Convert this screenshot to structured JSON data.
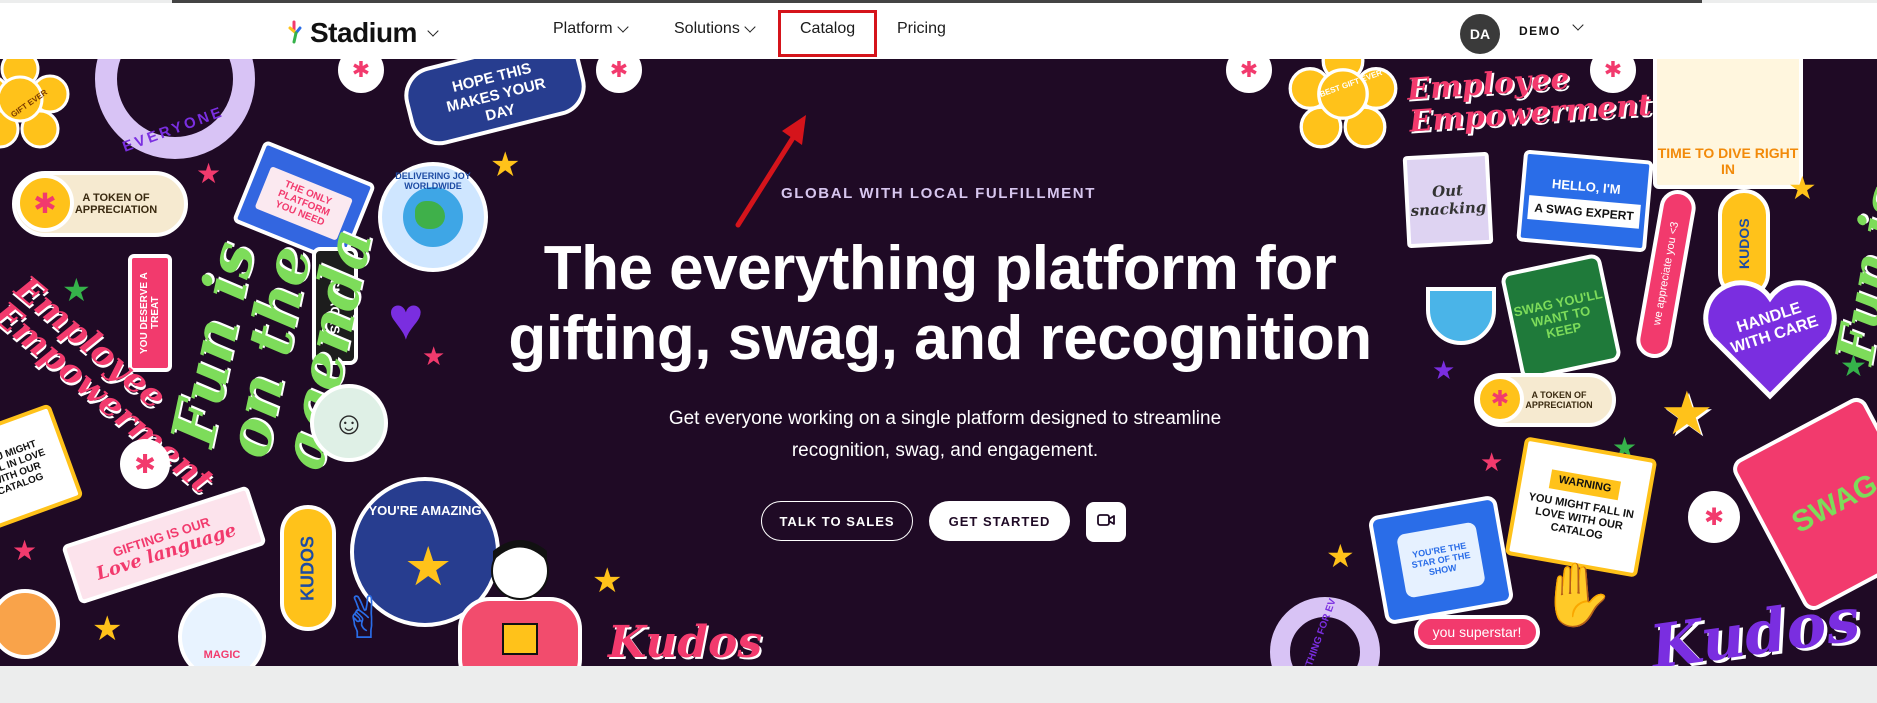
{
  "nav": {
    "logo_text": "Stadium",
    "items": [
      {
        "label": "Platform"
      },
      {
        "label": "Solutions"
      },
      {
        "label": "Catalog"
      },
      {
        "label": "Pricing"
      }
    ],
    "avatar_initials": "DA",
    "user_label": "DEMO"
  },
  "hero": {
    "eyebrow": "GLOBAL WITH LOCAL FULFILLMENT",
    "headline_line1": "The everything platform for",
    "headline_line2": "gifting, swag, and recognition",
    "sub_line1": "Get everyone working on a single platform designed to streamline",
    "sub_line2": "recognition, swag, and engagement.",
    "cta_primary": "TALK TO SALES",
    "cta_secondary": "GET STARTED",
    "video_icon": "video-camera-icon"
  },
  "stickers": {
    "everyone": "EVERYONE",
    "hope": "HOPE THIS MAKES YOUR DAY",
    "only_platform": "THE ONLY PLATFORM YOU NEED",
    "token_left": "A TOKEN OF APPRECIATION",
    "delivering": "DELIVERING JOY WORLDWIDE",
    "you_deserve": "YOU DESERVE A TREAT",
    "snacks": "SNACKS",
    "fun_left": "Fun is on the agenda",
    "gifting": "GIFTING IS OUR",
    "love_language": "Love language",
    "kudos_left": "KUDOS",
    "amazing": "YOU'RE AMAZING",
    "kudos_script_left": "Kudos",
    "employee": "Employee Empowerment",
    "out_snacking": "Out snacking",
    "hello": "HELLO, I'M",
    "swag_expert": "A SWAG EXPERT",
    "time_to_dive": "TIME TO DIVE RIGHT IN",
    "swag_mug": "SWAG YOU'LL WANT TO KEEP",
    "appreciate": "we appreciate you <3",
    "kudos_right": "KUDOS",
    "handle": "HANDLE WITH CARE",
    "token_right": "A TOKEN OF APPRECIATION",
    "warning": "WARNING",
    "fall_in_love": "YOU MIGHT FALL IN LOVE WITH OUR CATALOG",
    "star_show": "YOU'RE THE STAR OF THE SHOW",
    "superstar": "you superstar!",
    "kudos_script_right": "Kudos",
    "swag": "SWAG",
    "fun_right": "Fun is on",
    "something_for": "SOMETHING FOR EV",
    "best_gift": "BEST GIFT EVER",
    "gift_ever": "GIFT EVER",
    "magic": "MAGIC"
  },
  "colors": {
    "hero_bg": "#1f0a25",
    "highlight": "#d5141b",
    "accent_pink": "#f23a6d",
    "accent_purple": "#7a2ee0",
    "accent_green": "#35b24a",
    "accent_yellow": "#ffc21a",
    "accent_blue": "#2a6de8"
  }
}
